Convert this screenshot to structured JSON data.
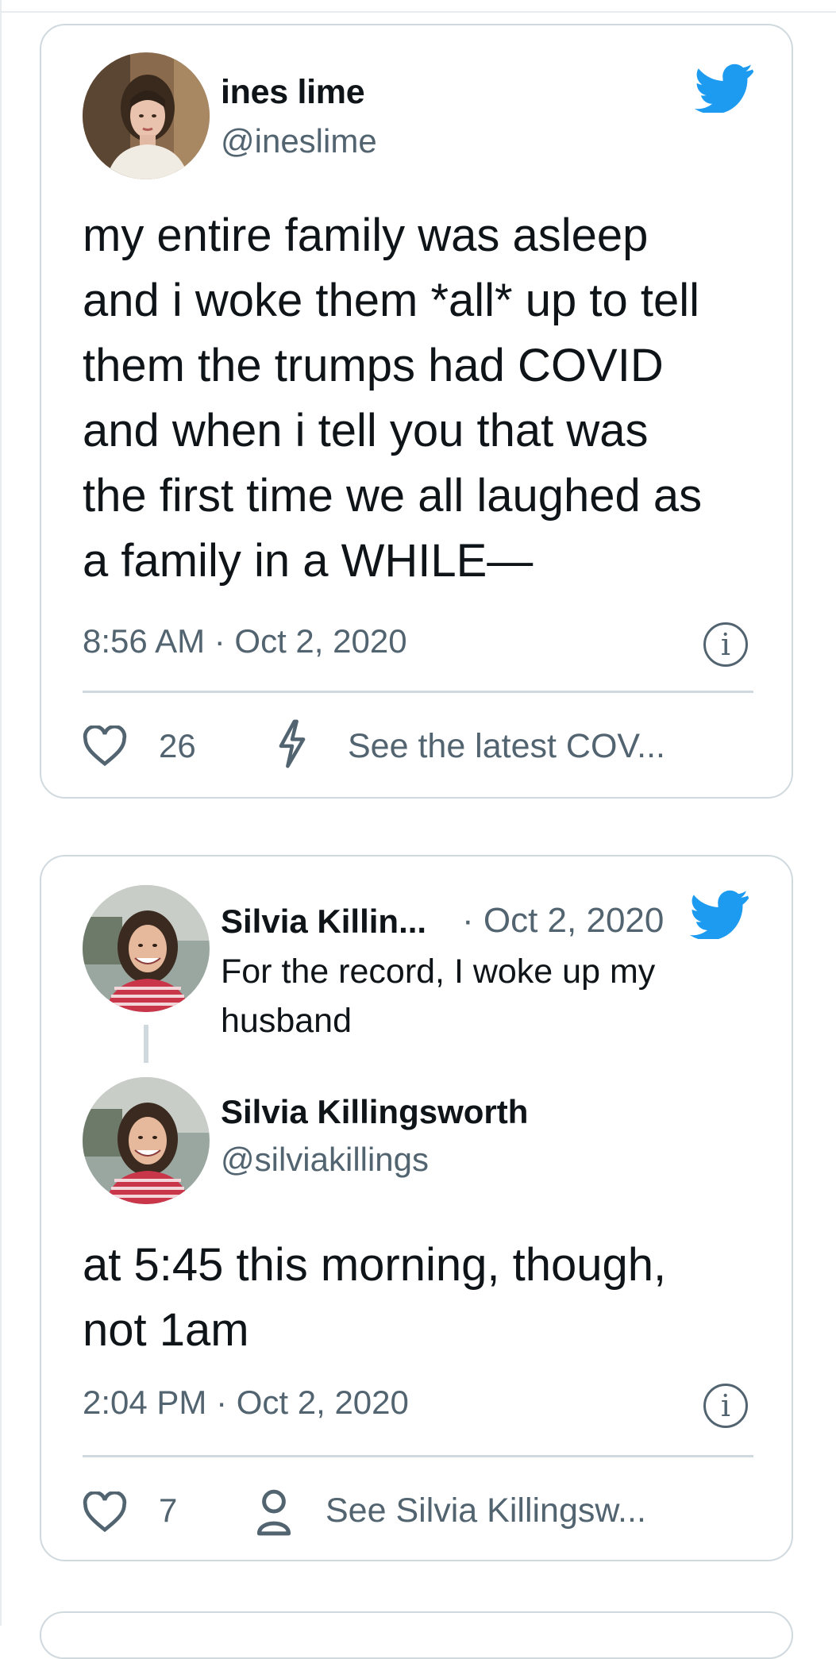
{
  "tweet": {
    "author_name": "ines lime",
    "author_handle": "@ineslime",
    "text_lines": [
      "my entire family was asleep",
      "and i woke them *all* up to tell",
      "them the trumps had COVID",
      "and when i tell you that was",
      "the first time we all laughed as",
      "a family in a WHILE—"
    ],
    "timestamp": "8:56 AM · Oct 2, 2020",
    "likes": "26",
    "link_label": "See the latest COV...",
    "info_glyph": "i"
  },
  "reply_tweet": {
    "quoted": {
      "author_name": "Silvia Killin...",
      "date": "· Oct 2, 2020",
      "text_lines": [
        "For the record, I woke up my",
        "husband"
      ]
    },
    "author_name": "Silvia Killingsworth",
    "author_handle": "@silviakillings",
    "text_lines": [
      "at 5:45 this morning, though,",
      "not 1am"
    ],
    "timestamp": "2:04 PM · Oct 2, 2020",
    "likes": "7",
    "link_label": "See Silvia Killingsw...",
    "info_glyph": "i"
  },
  "colors": {
    "twitter_blue": "#1d9bf0",
    "secondary_text": "#536471",
    "border": "#cfd9de"
  },
  "icons": [
    "twitter-bird-icon",
    "heart-icon",
    "lightning-icon",
    "person-icon",
    "info-icon"
  ]
}
